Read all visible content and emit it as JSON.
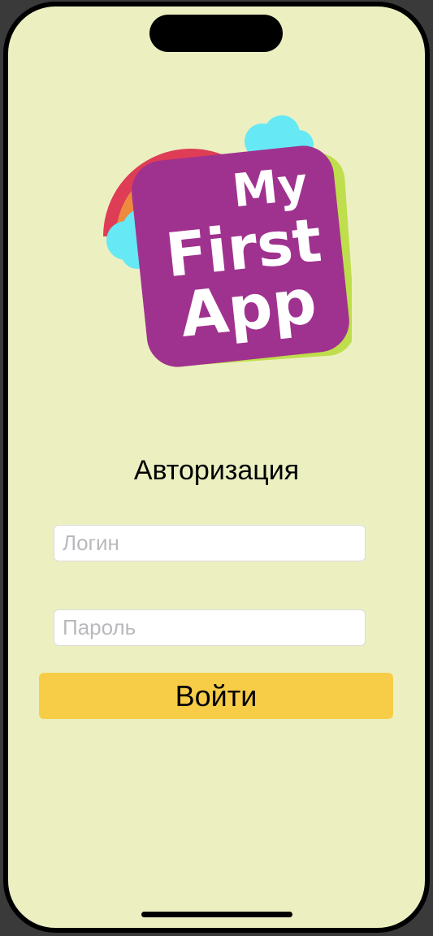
{
  "logo": {
    "line1": "My",
    "line2": "First",
    "line3": "App",
    "icon": "rainbow-cloud-logo-icon"
  },
  "login_form": {
    "title": "Авторизация",
    "login_placeholder": "Логин",
    "password_placeholder": "Пароль",
    "submit_label": "Войти"
  },
  "colors": {
    "background": "#ecf0c1",
    "logo_tile": "#a0328f",
    "logo_back_tile": "#bede4c",
    "cloud": "#66e8f5",
    "button": "#f7cd48"
  }
}
